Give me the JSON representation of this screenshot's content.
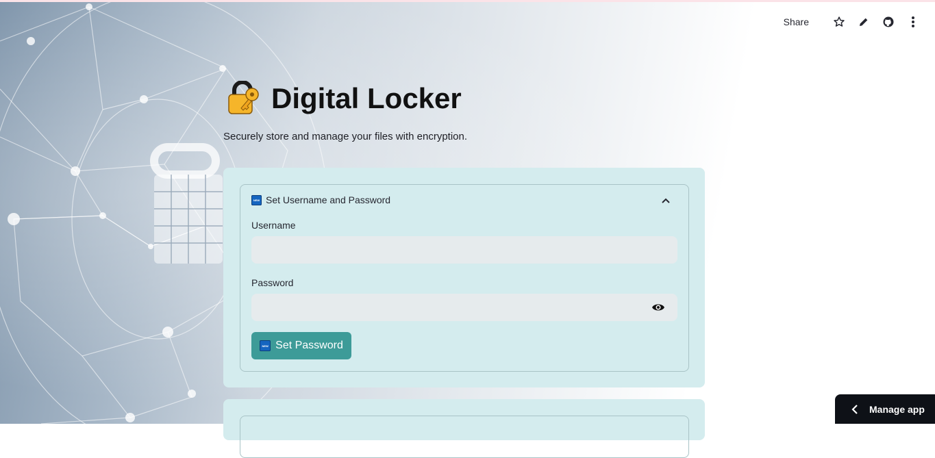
{
  "toolbar": {
    "share_label": "Share",
    "icons": [
      "star-icon",
      "pencil-icon",
      "github-icon",
      "more-vert-icon"
    ]
  },
  "header": {
    "title": "Digital Locker",
    "subtitle": "Securely store and manage your files with encryption.",
    "icon": "locked-with-key-emoji"
  },
  "set_password_section": {
    "expander_title": "Set Username and Password",
    "expander_icon": "new-badge-icon",
    "expanded": true,
    "username_label": "Username",
    "username_value": "",
    "password_label": "Password",
    "password_value": "",
    "button_label": "Set Password",
    "button_icon": "new-badge-icon",
    "badge_text": "NEW"
  },
  "manage_app": {
    "label": "Manage app"
  },
  "colors": {
    "card_bg": "#d4ecee",
    "button_bg": "#3d9b98",
    "manage_bg": "#0e1117"
  }
}
